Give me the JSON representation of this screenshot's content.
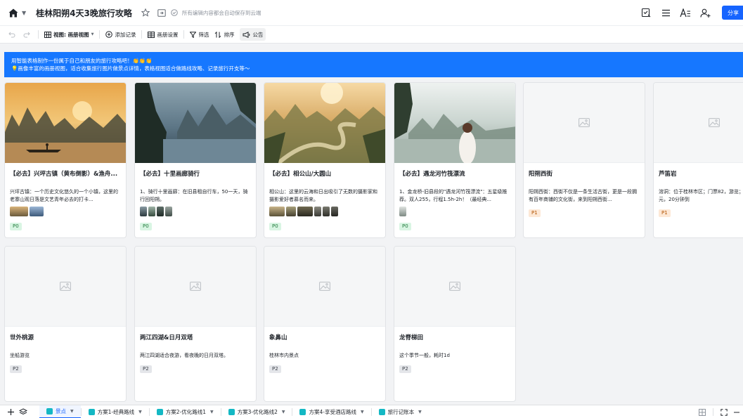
{
  "header": {
    "title": "桂林阳朔4天3晚旅行攻略",
    "save_note": "所有编辑内容都会自动保存到云端",
    "share_label": "分享"
  },
  "toolbar": {
    "view_label": "视图: 画册视图",
    "add_record": "添加记录",
    "gallery_settings": "画册设置",
    "filter": "筛选",
    "sort": "排序",
    "announcement": "公告"
  },
  "banner": {
    "line1": "用智能表格制作一份属于自己和朋友的旅行攻略吧！👏👏👏",
    "line2": "💡画像丰富的画册视图，适合收集旅行图片做景点详情，表格视图适合做路线攻略、记录旅行开支等～"
  },
  "cards": [
    {
      "title": "【必去】兴坪古镇（黄布倒影）&渔舟...",
      "desc": "兴坪古镇：一个历史文化悠久的一个小镇，这里的老寨山观日落是文艺青年必去的打卡...",
      "tag": "P0"
    },
    {
      "title": "【必去】十里画廊骑行",
      "desc": "1、骑行十里画廊：在旧县租自行车，50一天，骑行回阳朔。",
      "tag": "P0"
    },
    {
      "title": "【必去】相公山/大圆山",
      "desc": "相公山：这里的云海和日出吸引了无数的摄影家和摄影爱好者慕名而来。",
      "tag": "P0"
    },
    {
      "title": "【必去】遇龙河竹筏漂流",
      "desc": "1、金龙桥-旧县段的\"遇龙河竹筏漂流\"：五星级推荐。双人255，行程1.5h-2h！（最经典...",
      "tag": "P0"
    },
    {
      "title": "阳朔西街",
      "desc": "阳朔西街：西街不仅是一条生活古街，更是一段拥有百年商铺的文化街，来到阳朔西街...",
      "tag": "P1"
    },
    {
      "title": "芦笛岩",
      "desc": "溶洞：位于桂林市区；门票82，游览；漓湾快车16元，20分钟到",
      "tag": "P1"
    },
    {
      "title": "世外桃源",
      "desc": "坐船游览",
      "tag": "P2"
    },
    {
      "title": "两江四湖&日月双塔",
      "desc": "两江四湖适合夜游，看夜晚的日月双塔。",
      "tag": "P2"
    },
    {
      "title": "象鼻山",
      "desc": "桂林市内景点",
      "tag": "P2"
    },
    {
      "title": "龙脊梯田",
      "desc": "这个季节一般，耗时1d",
      "tag": "P2"
    }
  ],
  "tabs": [
    "景点",
    "方案1-经典路线",
    "方案2-优化路线1",
    "方案3-优化路线2",
    "方案4-享受酒店路线",
    "旅行记账本"
  ],
  "icons": {
    "home": "home-icon",
    "star": "star-icon",
    "move": "move-to-folder-icon",
    "cloud": "cloud-saved-icon",
    "verify": "checklist-icon",
    "menu": "hamburger-menu-icon",
    "font": "text-format-icon",
    "add_user": "add-user-icon",
    "image_placeholder": "image-placeholder-icon"
  },
  "colors": {
    "accent": "#1664ff",
    "banner": "#1677ff",
    "p0": "#d9f5e3",
    "p1": "#fde8d6",
    "p2": "#e4e6ea"
  }
}
